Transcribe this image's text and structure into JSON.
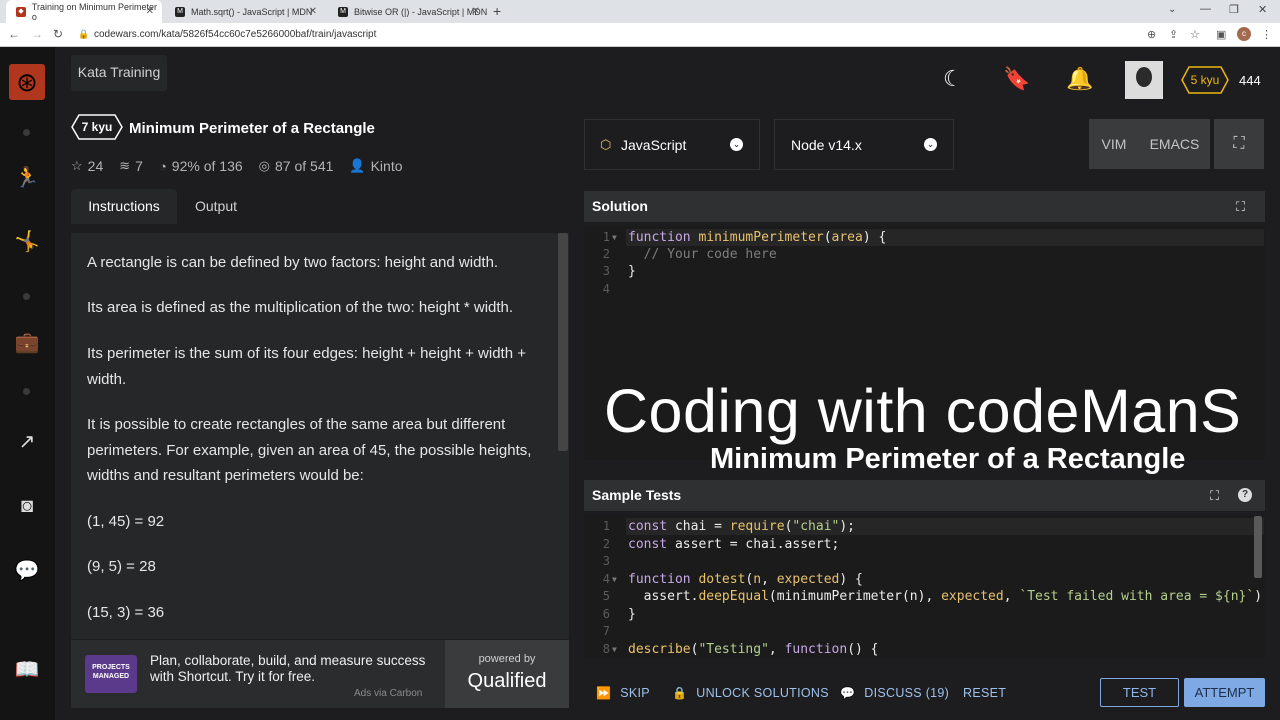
{
  "browser": {
    "tabs": [
      {
        "label": "Training on Minimum Perimeter o",
        "favicon": "codewars-icon"
      },
      {
        "label": "Math.sqrt() - JavaScript | MDN",
        "favicon": "mdn-icon"
      },
      {
        "label": "Bitwise OR (|) - JavaScript | MDN",
        "favicon": "mdn-icon"
      }
    ],
    "new_tab": "+",
    "url": "codewars.com/kata/5826f54cc60c7e5266000baf/train/javascript"
  },
  "header": {
    "section": "Kata Training",
    "rank": "5 kyu",
    "honor": "444"
  },
  "kata": {
    "kyu": "7 kyu",
    "title": "Minimum Perimeter of a Rectangle",
    "stars": "24",
    "collections": "7",
    "satisfaction": "92%",
    "votes": "of 136",
    "completed": "87",
    "attempts": "of 541",
    "author": "Kinto"
  },
  "tabs": {
    "instructions": "Instructions",
    "output": "Output"
  },
  "description": [
    "A rectangle is can be defined by two factors: height and width.",
    "Its area is defined as the multiplication of the two: height * width.",
    "Its perimeter is the sum of its four edges: height + height + width + width.",
    "It is possible to create rectangles of the same area but different perimeters. For example, given an area of 45, the possible heights, widths and resultant perimeters would be:",
    "(1, 45) = 92",
    "(9, 5) = 28",
    "(15, 3) = 36"
  ],
  "ad": {
    "image_text": "PROJECTS MANAGED",
    "text": "Plan, collaborate, build, and measure success with Shortcut. Try it for free.",
    "via": "Ads via Carbon",
    "powered_by": "powered by",
    "brand": "Qualified"
  },
  "editor": {
    "language": "JavaScript",
    "runtime": "Node v14.x",
    "modes": [
      "VIM",
      "EMACS"
    ],
    "solution_title": "Solution",
    "tests_title": "Sample Tests"
  },
  "solution_code": [
    {
      "n": "1",
      "parts": [
        [
          "kw",
          "function "
        ],
        [
          "fn",
          "minimumPerimeter"
        ],
        [
          "",
          "("
        ],
        [
          "prm",
          "area"
        ],
        [
          "",
          ") {"
        ]
      ]
    },
    {
      "n": "2",
      "parts": [
        [
          "cmt",
          "  // Your code here"
        ]
      ]
    },
    {
      "n": "3",
      "parts": [
        [
          "",
          "}"
        ]
      ]
    },
    {
      "n": "4",
      "parts": []
    }
  ],
  "test_code": [
    {
      "n": "1",
      "parts": [
        [
          "kw",
          "const "
        ],
        [
          "",
          "chai = "
        ],
        [
          "fn",
          "require"
        ],
        [
          "",
          "("
        ],
        [
          "str",
          "\"chai\""
        ],
        [
          "",
          ");"
        ]
      ]
    },
    {
      "n": "2",
      "parts": [
        [
          "kw",
          "const "
        ],
        [
          "",
          "assert = chai.assert;"
        ]
      ]
    },
    {
      "n": "3",
      "parts": []
    },
    {
      "n": "4",
      "parts": [
        [
          "kw",
          "function "
        ],
        [
          "fn",
          "dotest"
        ],
        [
          "",
          "("
        ],
        [
          "prm",
          "n"
        ],
        [
          "",
          ", "
        ],
        [
          "prm",
          "expected"
        ],
        [
          "",
          ") {"
        ]
      ]
    },
    {
      "n": "5",
      "parts": [
        [
          "",
          "  assert."
        ],
        [
          "fn",
          "deepEqual"
        ],
        [
          "",
          "(minimumPerimeter(n), "
        ],
        [
          "prm",
          "expected"
        ],
        [
          "",
          ", "
        ],
        [
          "str",
          "`Test failed with area = ${n}`"
        ],
        [
          "",
          ")"
        ]
      ]
    },
    {
      "n": "6",
      "parts": [
        [
          "",
          "}"
        ]
      ]
    },
    {
      "n": "7",
      "parts": []
    },
    {
      "n": "8",
      "parts": [
        [
          "fn",
          "describe"
        ],
        [
          "",
          "("
        ],
        [
          "str",
          "\"Testing\""
        ],
        [
          "",
          ", "
        ],
        [
          "kw",
          "function"
        ],
        [
          "",
          "() {"
        ]
      ]
    }
  ],
  "overlay": {
    "line1": "Coding with codeManS",
    "line2": "Minimum Perimeter of a Rectangle"
  },
  "actions": {
    "skip": "SKIP",
    "unlock": "UNLOCK SOLUTIONS",
    "discuss": "DISCUSS (19)",
    "reset": "RESET",
    "test": "TEST",
    "attempt": "ATTEMPT"
  },
  "colors": {
    "brand_red": "#b1361e",
    "accent_blue": "#7fa9e4",
    "badge_yellow": "#ecb613"
  }
}
